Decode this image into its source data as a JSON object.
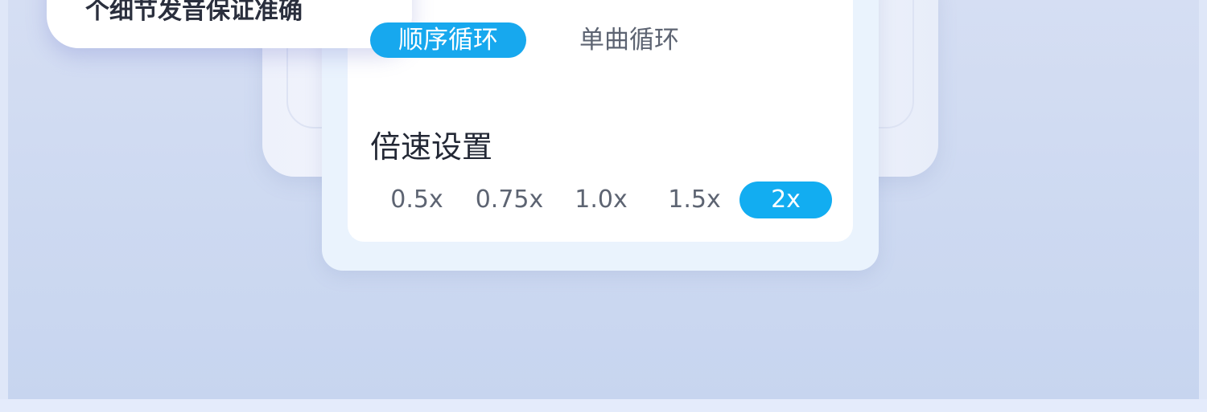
{
  "tooltip": {
    "text": "个细节发音保证准确"
  },
  "loop_mode": {
    "options": [
      {
        "label": "顺序循环",
        "selected": true
      },
      {
        "label": "单曲循环",
        "selected": false
      }
    ]
  },
  "speed_setting": {
    "title": "倍速设置",
    "options": [
      {
        "label": "0.5x",
        "selected": false
      },
      {
        "label": "0.75x",
        "selected": false
      },
      {
        "label": "1.0x",
        "selected": false
      },
      {
        "label": "1.5x",
        "selected": false
      },
      {
        "label": "2x",
        "selected": true
      }
    ]
  },
  "colors": {
    "accent": "#17a8ee",
    "background": "#cdd9f1",
    "text_primary": "#232835",
    "text_secondary": "#5d6472"
  }
}
